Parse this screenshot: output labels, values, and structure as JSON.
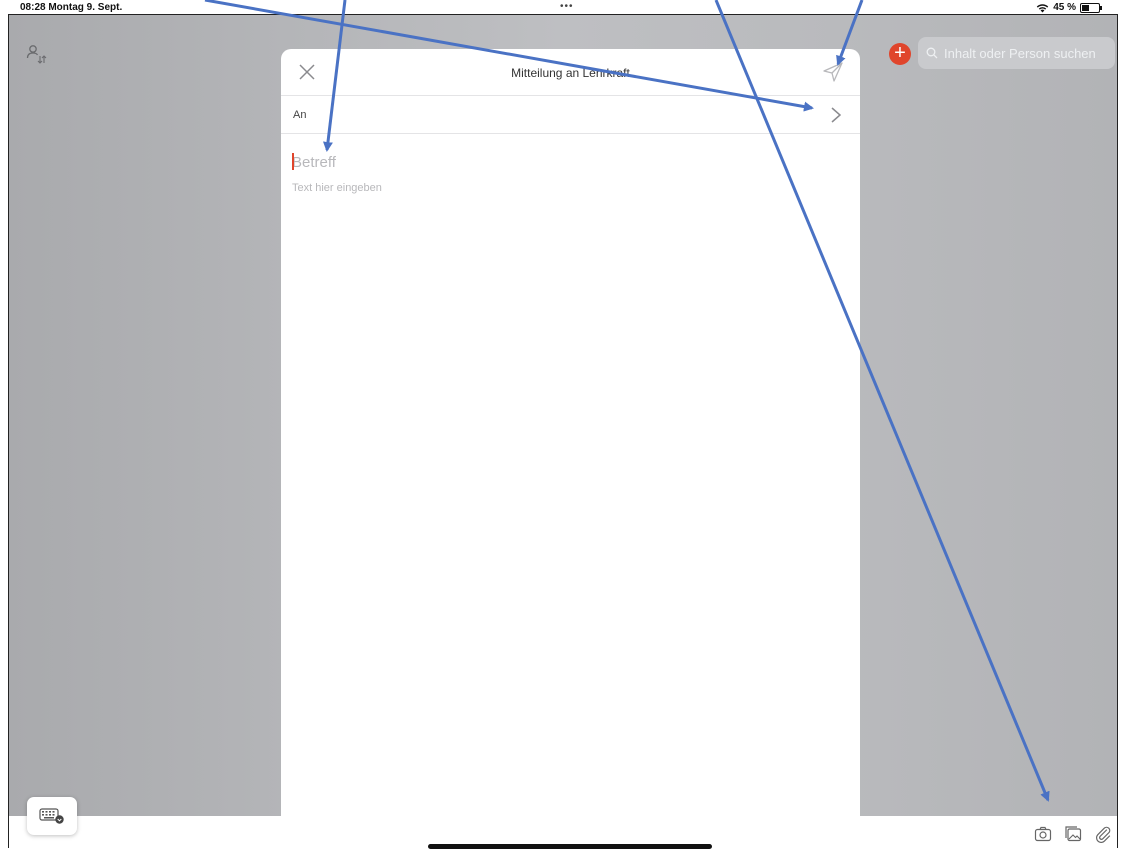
{
  "status_bar": {
    "time_date": "08:28  Montag 9. Sept.",
    "dots": "•••",
    "battery_text": "45 %"
  },
  "background_app": {
    "search_placeholder": "Inhalt oder Person suchen",
    "add_symbol": "+"
  },
  "modal": {
    "title": "Mitteilung an Lehrkraft",
    "to_label": "An",
    "subject_placeholder": "Betreff",
    "body_placeholder": "Text hier eingeben"
  },
  "icons": {
    "close": "close-icon",
    "send": "send-icon",
    "chevron": "chevron-right-icon",
    "people": "person-switch-icon",
    "keyboard": "keyboard-icon",
    "camera": "camera-icon",
    "photo": "photo-library-icon",
    "attachment": "paperclip-icon"
  },
  "colors": {
    "accent": "#e0452c",
    "arrow": "#4a72c4"
  }
}
